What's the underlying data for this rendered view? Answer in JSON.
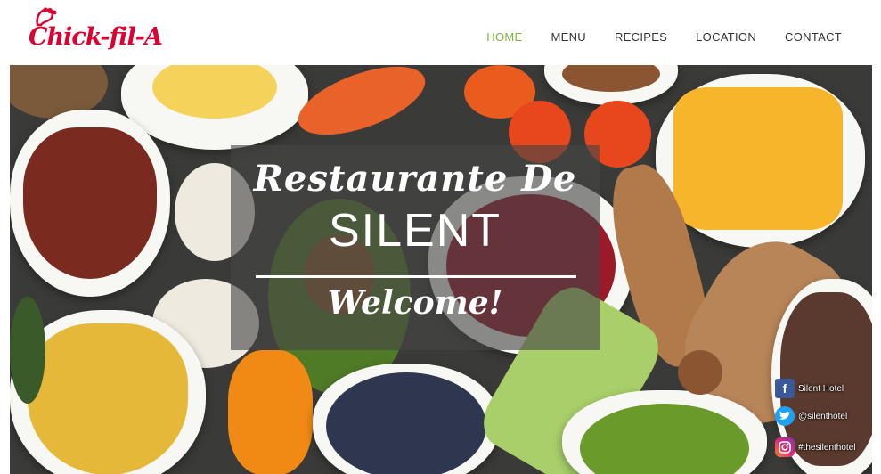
{
  "header": {
    "logo_text": "Chick-fil-A",
    "nav": [
      {
        "label": "HOME",
        "active": true
      },
      {
        "label": "MENU",
        "active": false
      },
      {
        "label": "RECIPES",
        "active": false
      },
      {
        "label": "LOCATION",
        "active": false
      },
      {
        "label": "CONTACT",
        "active": false
      }
    ]
  },
  "hero": {
    "title": "Restaurante De",
    "name": "SILENT",
    "welcome": "Welcome!"
  },
  "social": [
    {
      "icon": "facebook-icon",
      "label": "Silent Hotel"
    },
    {
      "icon": "twitter-icon",
      "label": "@silenthotel"
    },
    {
      "icon": "instagram-icon",
      "label": "#thesilenthotel"
    }
  ],
  "colors": {
    "brand_red": "#dd0031",
    "nav_active": "#7bb342",
    "facebook": "#3b5998",
    "twitter": "#1da1f2",
    "instagram": "#c13584"
  }
}
